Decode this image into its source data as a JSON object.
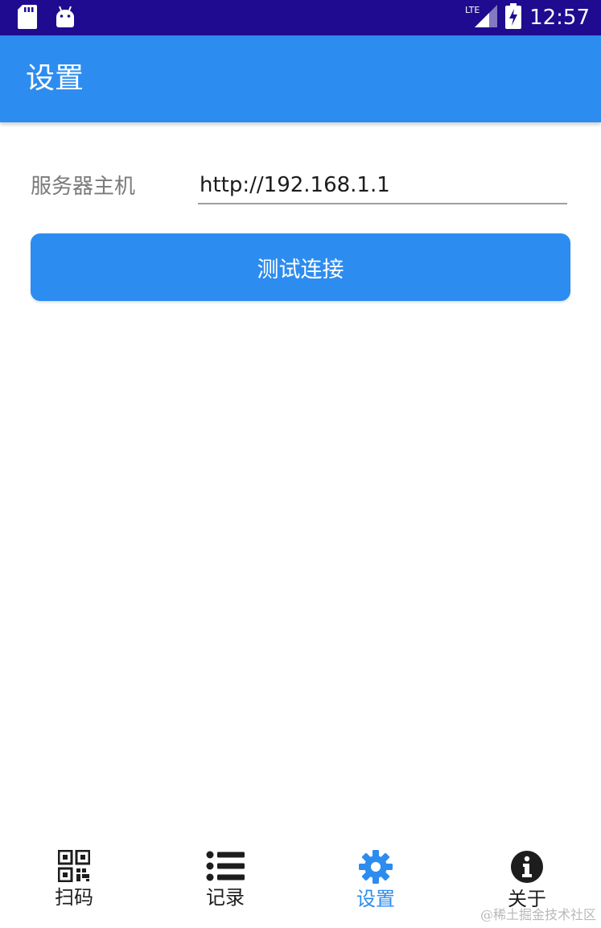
{
  "status_bar": {
    "time": "12:57",
    "network": "LTE",
    "icons": [
      "sd-card-icon",
      "android-icon",
      "lte-signal-icon",
      "battery-charging-icon"
    ]
  },
  "app_bar": {
    "title": "设置"
  },
  "settings": {
    "server_label": "服务器主机",
    "server_value": "http://192.168.1.1",
    "test_button_label": "测试连接"
  },
  "bottom_nav": {
    "items": [
      {
        "label": "扫码",
        "icon": "qr-code-icon",
        "active": false
      },
      {
        "label": "记录",
        "icon": "list-icon",
        "active": false
      },
      {
        "label": "设置",
        "icon": "gear-icon",
        "active": true
      },
      {
        "label": "关于",
        "icon": "info-icon",
        "active": false
      }
    ]
  },
  "watermark": "@稀土掘金技术社区",
  "colors": {
    "primary": "#2d8cef",
    "status_bar": "#1f0b8f",
    "label_gray": "#7a7a7a",
    "nav_inactive": "#1d1d1d"
  }
}
